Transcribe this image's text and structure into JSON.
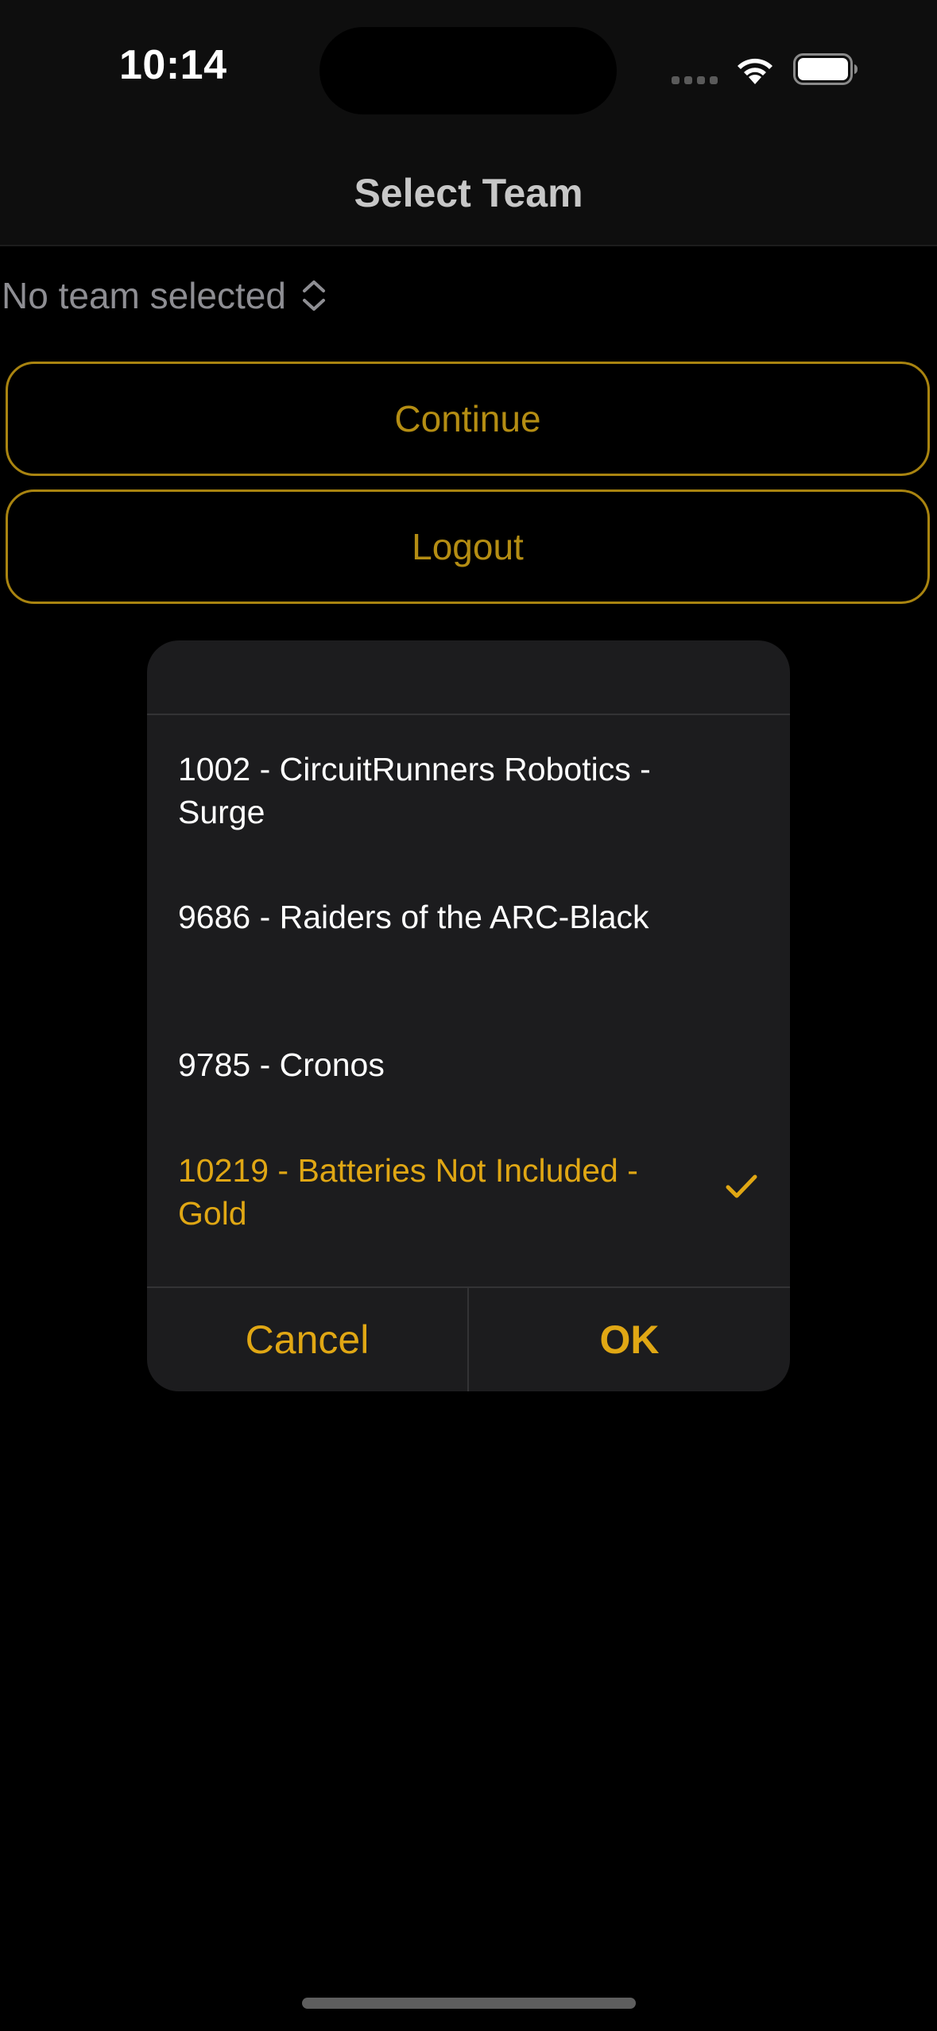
{
  "status_bar": {
    "time": "10:14",
    "icons": [
      "cellular-signal-icon",
      "wifi-icon",
      "battery-icon"
    ]
  },
  "nav": {
    "title": "Select Team"
  },
  "team_picker": {
    "value": "No team selected",
    "icon": "chevron-up-down-icon"
  },
  "buttons": {
    "continue_label": "Continue",
    "logout_label": "Logout"
  },
  "dialog": {
    "title": "",
    "options": [
      {
        "label": "1002 - CircuitRunners Robotics - Surge",
        "selected": false
      },
      {
        "label": "9686 - Raiders of the ARC-Black",
        "selected": false
      },
      {
        "label": "9785 - Cronos",
        "selected": false
      },
      {
        "label": "10219 - Batteries Not Included - Gold",
        "selected": true
      }
    ],
    "cancel_label": "Cancel",
    "ok_label": "OK"
  },
  "colors": {
    "accent": "#e0a714",
    "button_border": "#a98410",
    "background": "#000000",
    "dialog_bg": "#1c1c1e"
  }
}
